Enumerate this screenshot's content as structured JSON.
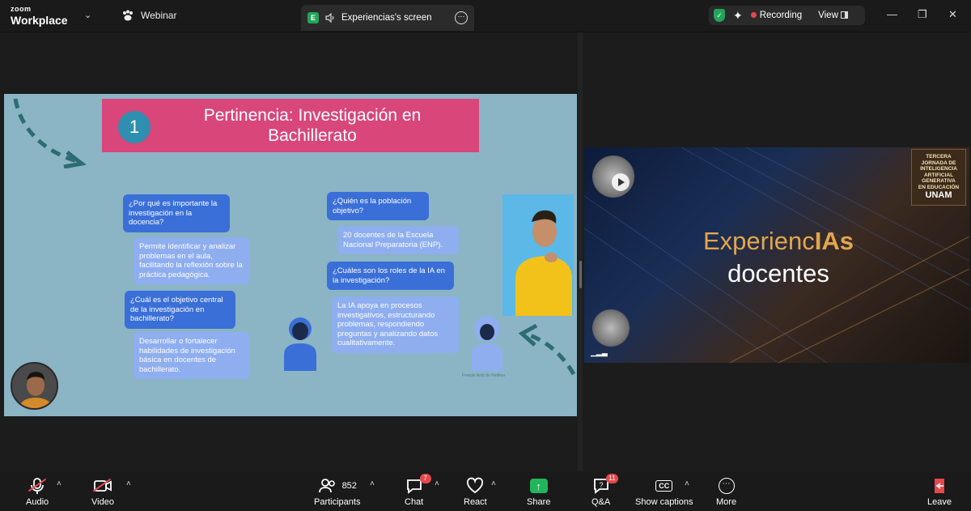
{
  "titlebar": {
    "brand_top": "zoom",
    "brand_bottom": "Workplace",
    "webinar_label": "Webinar",
    "share_badge": "E",
    "share_title": "Experiencias's screen",
    "recording_label": "Recording",
    "view_label": "View"
  },
  "slide": {
    "number": "1",
    "title": "Pertinencia: Investigación en Bachillerato",
    "bubbles": [
      "¿Por qué es importante la investigación en la docencia?",
      "Permite identificar y analizar problemas en el aula, facilitando la reflexión sobre la práctica pedagógica.",
      "¿Cuál es el objetivo central de la investigación en bachillerato?",
      "Desarrollar o fortalecer habilidades de investigación básica en docentes de bachillerato.",
      "¿Quién es la población objetivo?",
      "20 docentes de la Escuela Nacional Preparatoria (ENP).",
      "¿Cuáles son los roles de la IA en la investigación?",
      "La IA apoya en procesos investigativos, estructurando problemas, respondiendo preguntas y analizando datos cualitativamente."
    ],
    "credit": "Freepik Amit de Rediker"
  },
  "event_video": {
    "badge_lines": [
      "TERCERA",
      "JORNADA DE",
      "INTELIGENCIA",
      "ARTIFICIAL",
      "GENERATIVA",
      "EN EDUCACIÓN"
    ],
    "badge_unam": "UNAM",
    "line1_a": "Experienc",
    "line1_b": "IAs",
    "line2": "docentes"
  },
  "toolbar": {
    "audio": "Audio",
    "video": "Video",
    "participants": "Participants",
    "participants_count": "852",
    "chat": "Chat",
    "chat_badge": "7",
    "react": "React",
    "share": "Share",
    "qa": "Q&A",
    "qa_badge": "11",
    "captions": "Show captions",
    "more": "More",
    "leave": "Leave"
  },
  "colors": {
    "slide_bg": "#8bb4c5",
    "title_box": "#d8467a",
    "question_bubble": "#3a6fd8",
    "answer_bubble": "#8eaeef",
    "accent_green": "#22a55a",
    "alert_red": "#e5484d"
  }
}
